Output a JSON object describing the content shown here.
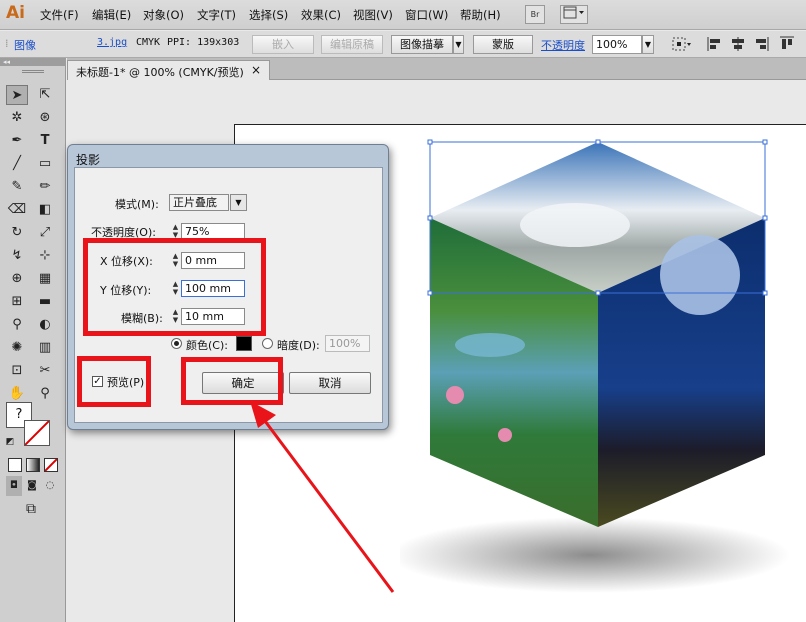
{
  "app": {
    "logo": "Ai"
  },
  "menu": [
    "文件(F)",
    "编辑(E)",
    "对象(O)",
    "文字(T)",
    "选择(S)",
    "效果(C)",
    "视图(V)",
    "窗口(W)",
    "帮助(H)"
  ],
  "menubar": {
    "bridge_label": "Br"
  },
  "control": {
    "type_label": "图像",
    "file_link": "3.jpg",
    "color_mode": "CMYK",
    "ppi": "PPI: 139x303",
    "embed_button": "嵌入",
    "edit_original_button": "编辑原稿",
    "image_trace_button": "图像描摹",
    "mask_button": "蒙版",
    "opacity_label": "不透明度",
    "opacity_value": "100%"
  },
  "document": {
    "tab_title": "未标题-1* @ 100% (CMYK/预览)",
    "tab_close": "×"
  },
  "dialog": {
    "title": "投影",
    "mode_label": "模式(M):",
    "mode_value": "正片叠底",
    "opacity_label": "不透明度(O):",
    "opacity_value": "75%",
    "x_offset_label": "X 位移(X):",
    "x_offset_value": "0 mm",
    "y_offset_label": "Y 位移(Y):",
    "y_offset_value": "100 mm",
    "blur_label": "模糊(B):",
    "blur_value": "10 mm",
    "color_label": "颜色(C):",
    "color_swatch": "#000000",
    "darkness_label": "暗度(D):",
    "darkness_value": "100%",
    "preview_label": "预览(P)",
    "ok_button": "确定",
    "cancel_button": "取消"
  },
  "toolbar": {
    "unknown_fill": "?"
  },
  "colors": {
    "highlight": "#e8141a",
    "accent_blue": "#1a4ec9"
  }
}
